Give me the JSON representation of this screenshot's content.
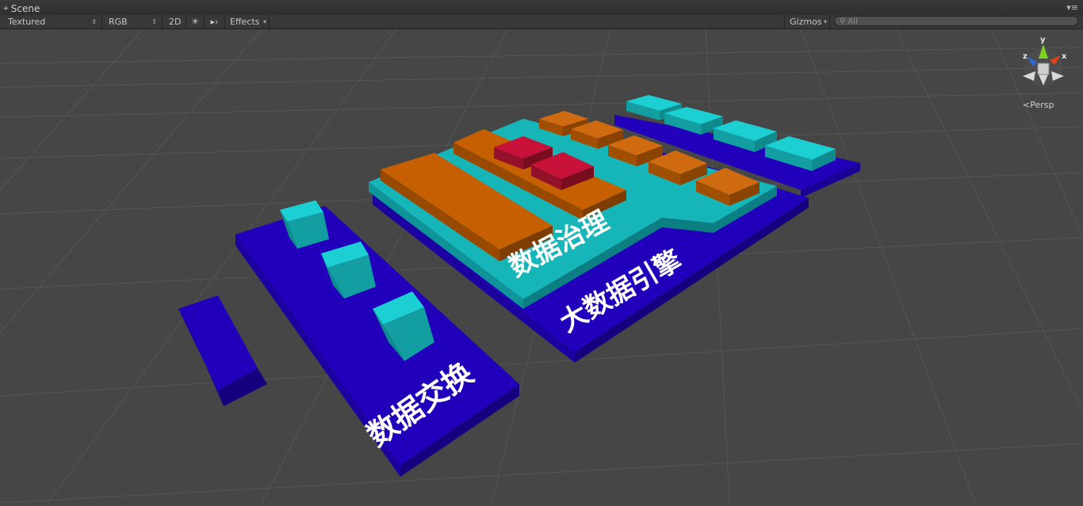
{
  "window": {
    "tab_title": "Scene",
    "tab_menu_icon": "menu-icon"
  },
  "toolbar": {
    "render_mode": "Textured",
    "color_mode": "RGB",
    "mode_2d": "2D",
    "lighting_icon": "sun-icon",
    "audio_icon": "speaker-icon",
    "effects_label": "Effects",
    "gizmos_label": "Gizmos",
    "search_placeholder": "All"
  },
  "gizmo": {
    "axis_y": "y",
    "axis_x": "x",
    "axis_z": "z",
    "projection": "Persp"
  },
  "scene_labels": {
    "governance": "数据治理",
    "engine": "大数据引擎",
    "exchange": "数据交换"
  },
  "colors": {
    "platform_blue": "#2200bb",
    "cyan_block": "#16b5b8",
    "orange_block": "#b25400",
    "red_block": "#b5102a",
    "viewport_bg": "#464646",
    "grid": "#565656"
  }
}
